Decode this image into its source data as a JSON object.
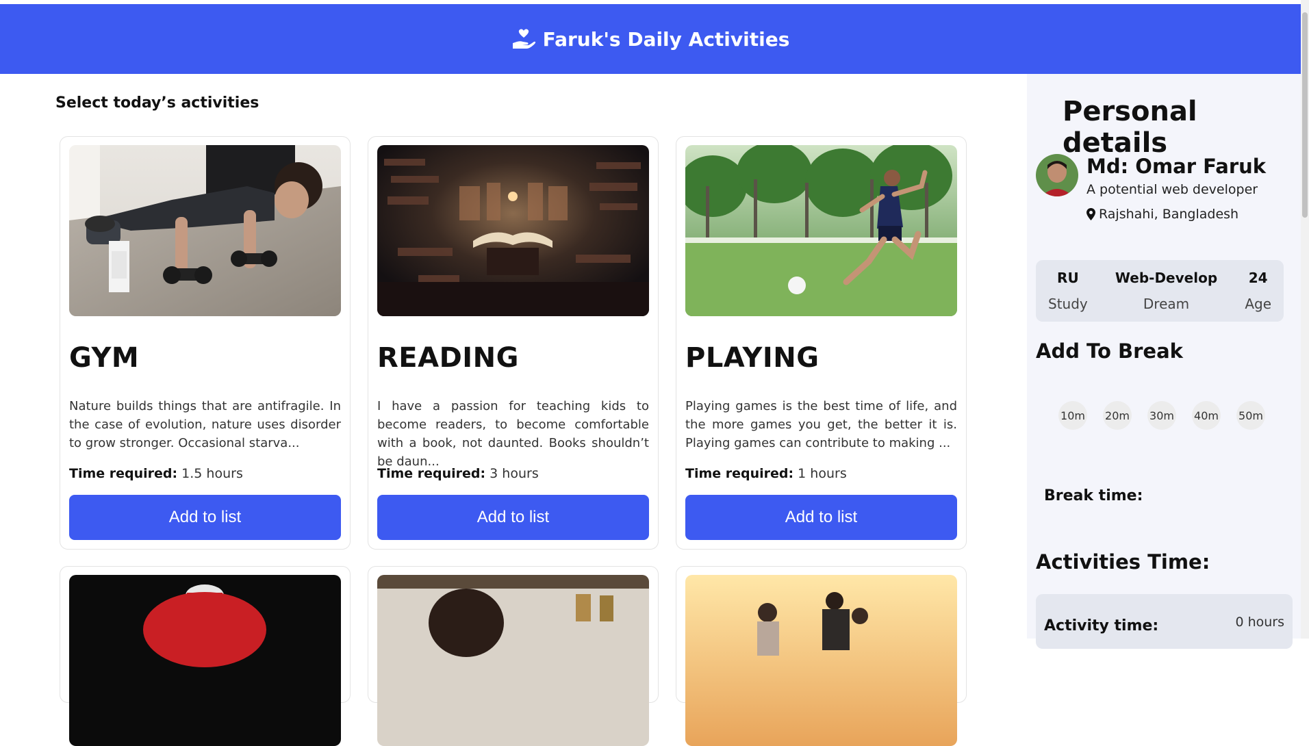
{
  "header": {
    "title": "Faruk's Daily Activities",
    "icon": "hand-holding-heart-icon"
  },
  "main": {
    "heading": "Select today’s activities",
    "cards": [
      {
        "title": "GYM",
        "description": "Nature builds things that are antifragile. In the case of evolution, nature uses disorder to grow stronger. Occasional starva...",
        "time_label": "Time required:",
        "time_value": "1.5 hours",
        "button": "Add to list"
      },
      {
        "title": "READING",
        "description": "I have a passion for teaching kids to become readers, to become comfortable with a book, not daunted. Books shouldn’t be daun...",
        "time_label": "Time required:",
        "time_value": "3 hours",
        "button": "Add to list"
      },
      {
        "title": "PLAYING",
        "description": "Playing games is the best time of life, and the more games you get, the better it is. Playing games can contribute to making ...",
        "time_label": "Time required:",
        "time_value": "1 hours",
        "button": "Add to list"
      }
    ]
  },
  "sidebar": {
    "title": "Personal details",
    "name": "Md: Omar Faruk",
    "tagline": "A potential web developer",
    "location": "Rajshahi, Bangladesh",
    "stats": [
      {
        "value": "RU",
        "label": "Study"
      },
      {
        "value": "Web-Develop",
        "label": "Dream"
      },
      {
        "value": "24",
        "label": "Age"
      }
    ],
    "break_heading": "Add To Break",
    "breaks": [
      "10m",
      "20m",
      "30m",
      "40m",
      "50m"
    ],
    "break_time_label": "Break time:",
    "activities_heading": "Activities Time:",
    "activity_time_label": "Activity time:",
    "activity_time_value": "0 hours"
  },
  "colors": {
    "accent": "#3d5af1",
    "sidebar_bg": "#f4f5fb",
    "stat_bg": "#e4e7ef"
  }
}
